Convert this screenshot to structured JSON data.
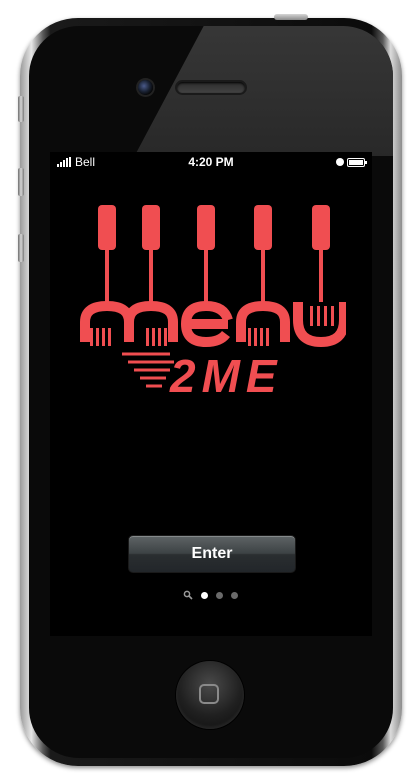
{
  "device": {
    "screen_bg": "#000000",
    "accent": "#f04e51"
  },
  "status_bar": {
    "carrier": "Bell",
    "time": "4:20 PM",
    "icons": [
      "signal-icon",
      "rotation-lock-icon",
      "battery-icon"
    ]
  },
  "logo": {
    "icon": "fork-logo-icon",
    "wordmark": "menu",
    "tagline": "2ME"
  },
  "enter_button": {
    "label": "Enter"
  },
  "page_indicator": {
    "icons": [
      "search-icon"
    ],
    "total_pages": 3,
    "current_page": 1
  },
  "home_button": {
    "icon": "home-square-icon"
  }
}
